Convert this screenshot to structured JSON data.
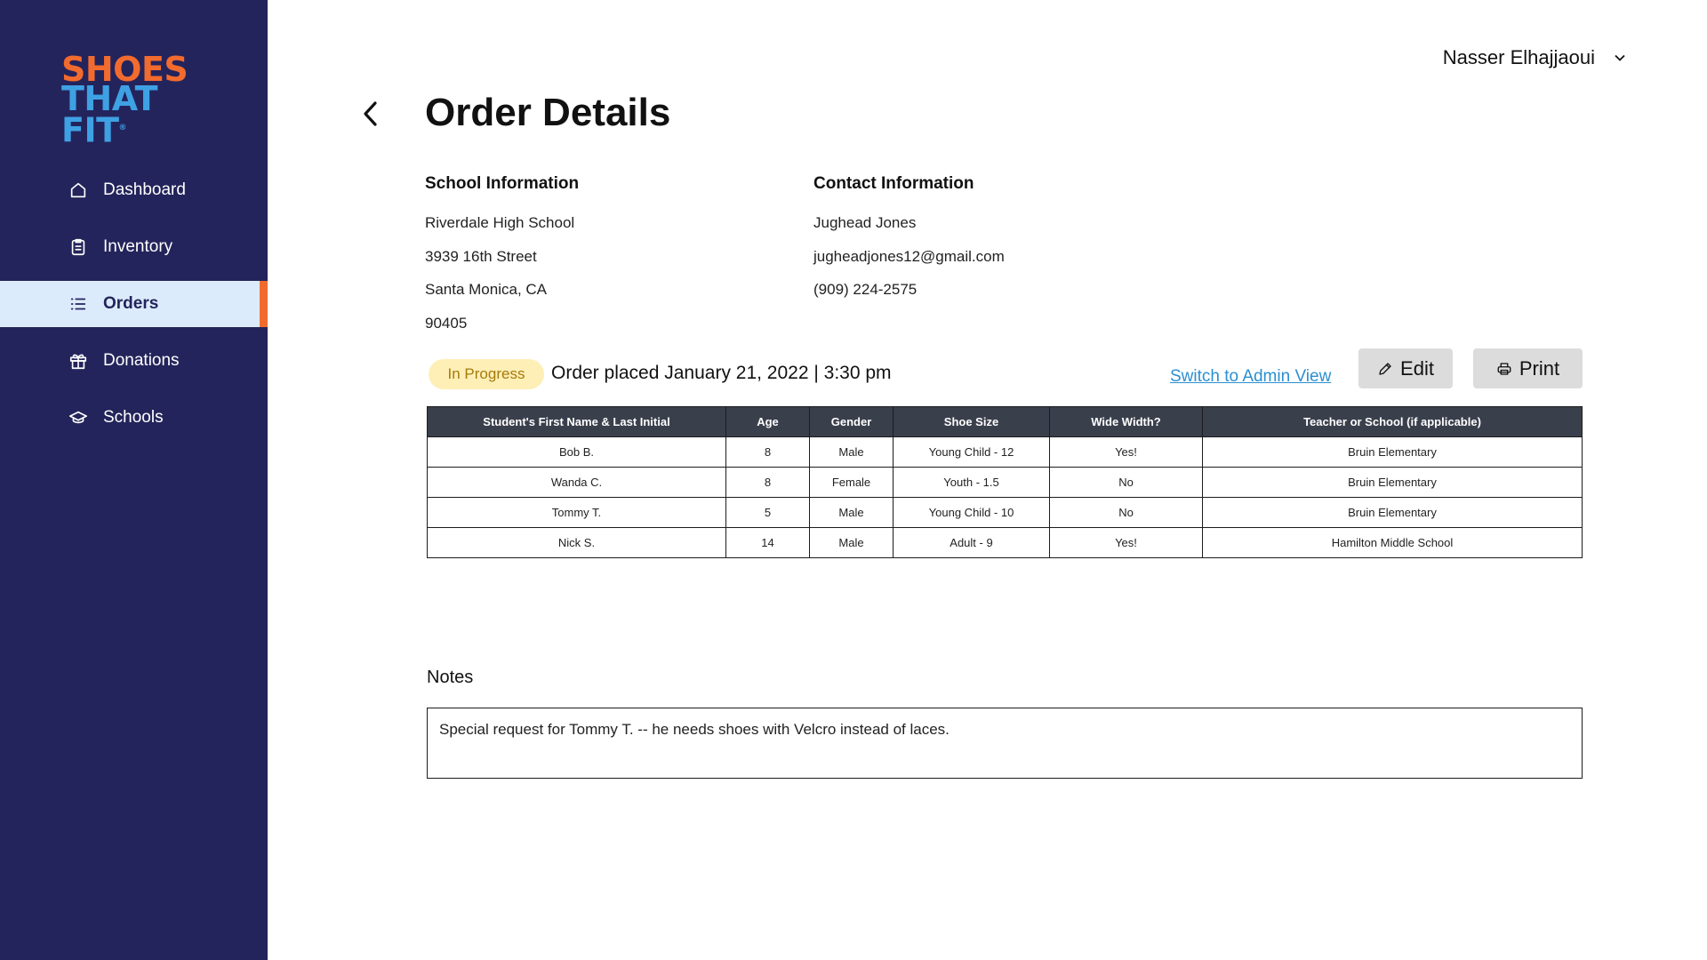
{
  "brand": {
    "line1": "SHOES",
    "line2": "THAT FIT",
    "orange": "#f26b2e",
    "blue": "#3ea1e4"
  },
  "sidebar": {
    "bg_color": "#24245c",
    "items": [
      {
        "label": "Dashboard",
        "icon": "home-icon",
        "active": false
      },
      {
        "label": "Inventory",
        "icon": "clipboard-icon",
        "active": false
      },
      {
        "label": "Orders",
        "icon": "list-icon",
        "active": true
      },
      {
        "label": "Donations",
        "icon": "gift-icon",
        "active": false
      },
      {
        "label": "Schools",
        "icon": "graduation-cap-icon",
        "active": false
      }
    ]
  },
  "header": {
    "user_name": "Nasser Elhajjaoui"
  },
  "page": {
    "title": "Order Details"
  },
  "school_info": {
    "heading": "School Information",
    "name": "Riverdale High School",
    "street": "3939 16th Street",
    "city": "Santa Monica, CA",
    "zip": "90405"
  },
  "contact_info": {
    "heading": "Contact Information",
    "name": "Jughead Jones",
    "email": "jugheadjones12@gmail.com",
    "phone": "(909) 224-2575"
  },
  "order": {
    "status": "In Progress",
    "status_color": "#fdefb6",
    "placed_text": "Order placed January 21, 2022 | 3:30 pm",
    "admin_link": "Switch to Admin View",
    "edit_label": "Edit",
    "print_label": "Print"
  },
  "table": {
    "columns": [
      "Student's First Name & Last Initial",
      "Age",
      "Gender",
      "Shoe Size",
      "Wide Width?",
      "Teacher or School (if applicable)"
    ],
    "rows": [
      [
        "Bob B.",
        "8",
        "Male",
        "Young Child - 12",
        "Yes!",
        "Bruin Elementary"
      ],
      [
        "Wanda C.",
        "8",
        "Female",
        "Youth - 1.5",
        "No",
        "Bruin Elementary"
      ],
      [
        "Tommy T.",
        "5",
        "Male",
        "Young Child - 10",
        "No",
        "Bruin Elementary"
      ],
      [
        "Nick S.",
        "14",
        "Male",
        "Adult - 9",
        "Yes!",
        "Hamilton Middle School"
      ]
    ]
  },
  "notes": {
    "label": "Notes",
    "text": "Special request for Tommy T. -- he needs shoes with Velcro instead of laces."
  }
}
